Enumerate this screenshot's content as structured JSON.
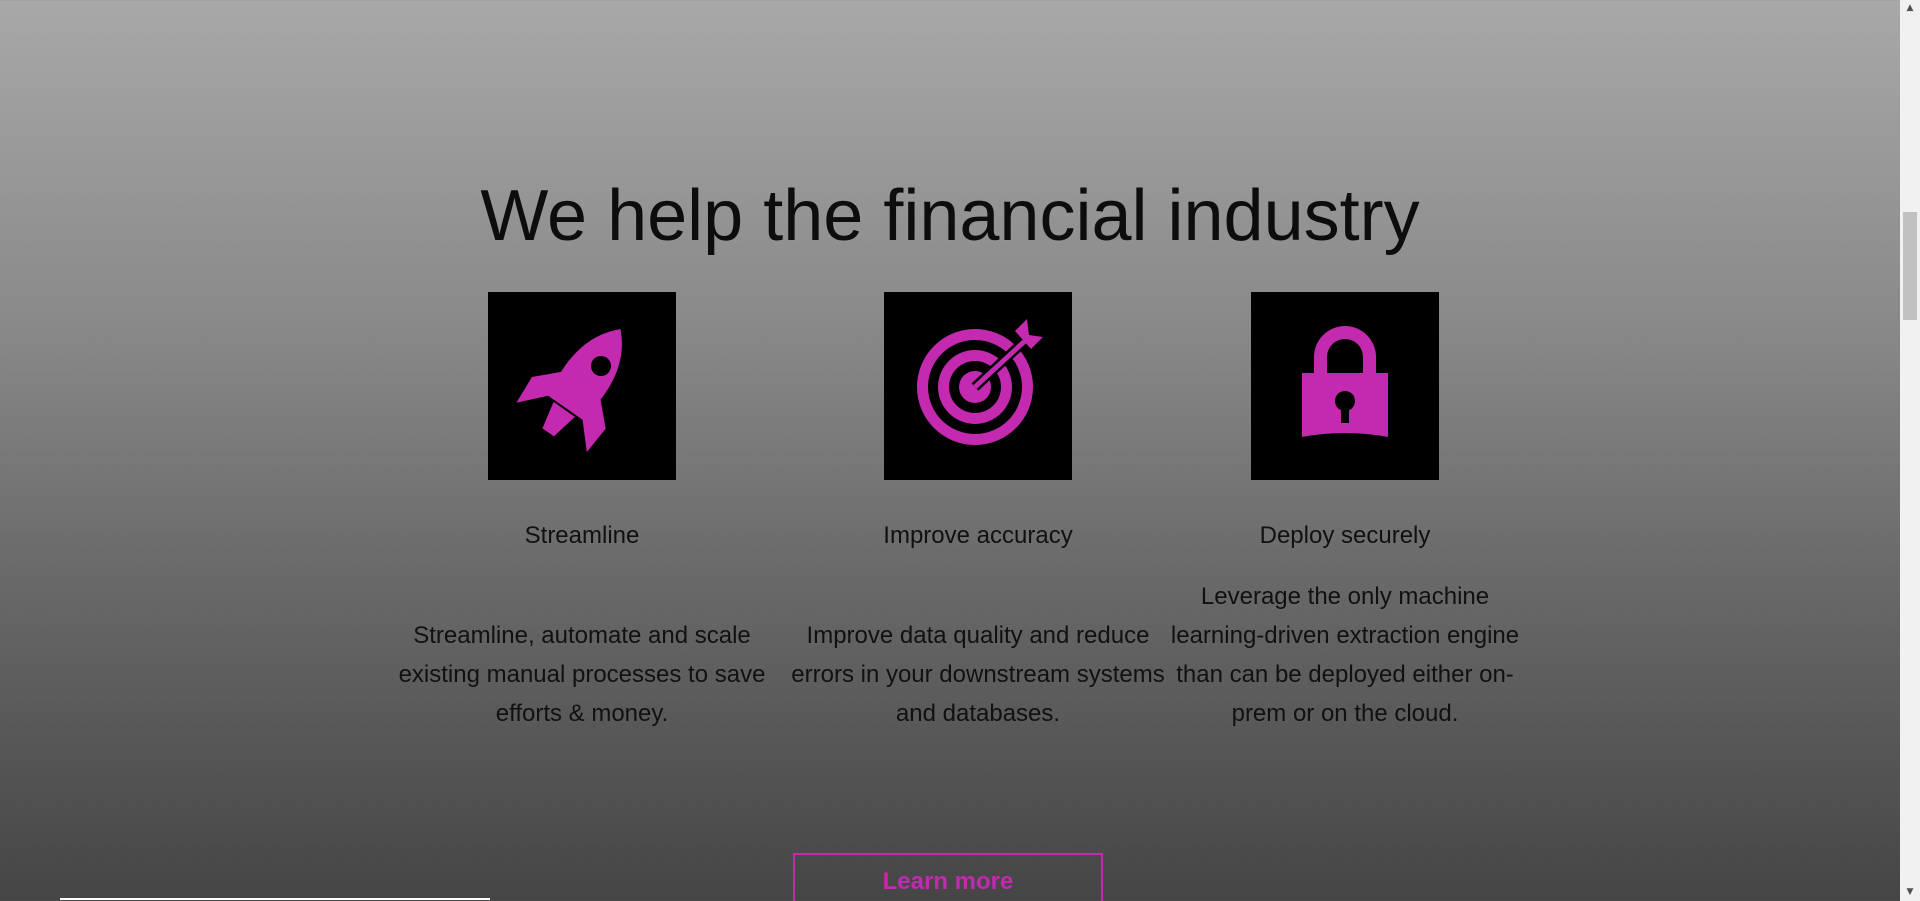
{
  "section": {
    "headline": "We help the financial industry"
  },
  "features": [
    {
      "icon": "rocket-icon",
      "title": "Streamline",
      "text": "Streamline, automate and scale existing manual processes to save efforts & money."
    },
    {
      "icon": "target-icon",
      "title": "Improve accuracy",
      "text": "Improve data quality and reduce errors in your downstream systems and databases."
    },
    {
      "icon": "lock-icon",
      "title": "Deploy securely",
      "text": "Leverage the only machine learning-driven extraction engine than can be deployed either on-prem or on the cloud."
    }
  ],
  "cta": {
    "label": "Learn more"
  },
  "colors": {
    "accent": "#c32ab0",
    "icon_bg": "#000000"
  }
}
